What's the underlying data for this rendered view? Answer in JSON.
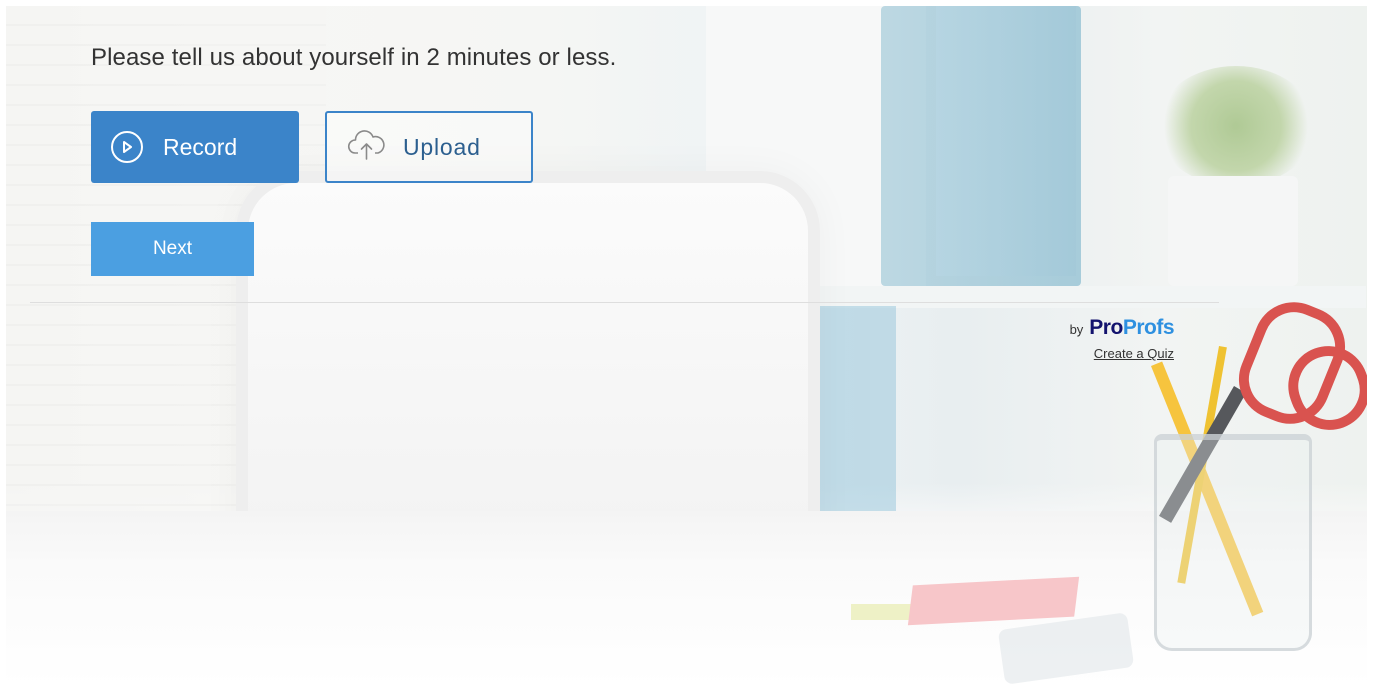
{
  "question": {
    "prompt": "Please tell us about yourself in 2 minutes or less."
  },
  "actions": {
    "record_label": "Record",
    "record_icon": "play-circle-icon",
    "upload_label": "Upload",
    "upload_icon": "cloud-upload-icon",
    "next_label": "Next"
  },
  "branding": {
    "by": "by",
    "logo_pro": "Pro",
    "logo_profs": "Profs",
    "create_quiz": "Create a Quiz"
  },
  "colors": {
    "primary": "#3b84c9",
    "next_button": "#4b9fe1",
    "logo_dark": "#13136e",
    "logo_light": "#2e90e0",
    "text": "#333333"
  }
}
